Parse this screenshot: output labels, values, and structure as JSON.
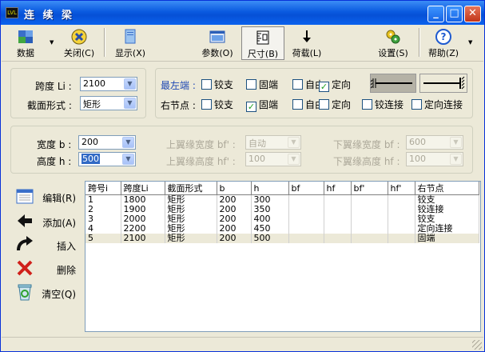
{
  "window": {
    "title": "连 续 梁",
    "app_icon_text": "LVL"
  },
  "titlebar_buttons": {
    "min": "_",
    "max": "□",
    "close": "✕"
  },
  "toolbar": {
    "data": {
      "label": "数据",
      "icon": "database-icon"
    },
    "close": {
      "label": "关闭(C)",
      "icon": "close-x-icon"
    },
    "show": {
      "label": "显示(X)",
      "icon": "document-icon"
    },
    "params": {
      "label": "参数(O)",
      "icon": "window-icon"
    },
    "size": {
      "label": "尺寸(B)",
      "icon": "ruler-icon"
    },
    "load": {
      "label": "荷载(L)",
      "icon": "arrow-down-icon"
    },
    "settings": {
      "label": "设置(S)",
      "icon": "gears-icon"
    },
    "help": {
      "label": "帮助(Z)",
      "icon": "help-icon"
    }
  },
  "span_group": {
    "span_label": "跨度 Li :",
    "span_value": "2100",
    "section_label": "截面形式 :",
    "section_value": "矩形"
  },
  "support_group": {
    "left_end_label": "最左端 :",
    "right_node_label": "右节点 :",
    "left_options": [
      {
        "label": "铰支",
        "checked": false
      },
      {
        "label": "固端",
        "checked": false
      },
      {
        "label": "自由",
        "checked": false
      },
      {
        "label": "定向",
        "checked": true
      }
    ],
    "right_options": [
      {
        "label": "铰支",
        "checked": false
      },
      {
        "label": "固端",
        "checked": true
      },
      {
        "label": "自由",
        "checked": false
      },
      {
        "label": "定向",
        "checked": false
      },
      {
        "label": "铰连接",
        "checked": false
      },
      {
        "label": "定向连接",
        "checked": false
      }
    ]
  },
  "size_group": {
    "width_label": "宽度 b :",
    "width_value": "200",
    "height_label": "高度 h :",
    "height_value": "500",
    "top_flange_width_label": "上翼缘宽度 bf' :",
    "top_flange_width_value": "自动",
    "top_flange_height_label": "上翼缘高度 hf' :",
    "top_flange_height_value": "100",
    "bottom_flange_width_label": "下翼缘宽度 bf :",
    "bottom_flange_width_value": "600",
    "bottom_flange_height_label": "下翼缘高度 hf :",
    "bottom_flange_height_value": "100"
  },
  "actions": {
    "edit": "编辑(R)",
    "add": "添加(A)",
    "insert": "插入",
    "delete": "删除",
    "clear": "清空(Q)"
  },
  "table": {
    "headers": [
      "跨号i",
      "跨度Li",
      "截面形式",
      "b",
      "h",
      "bf",
      "hf",
      "bf'",
      "hf'",
      "右节点"
    ],
    "rows": [
      [
        "1",
        "1800",
        "矩形",
        "200",
        "300",
        "",
        "",
        "",
        "",
        "铰支"
      ],
      [
        "2",
        "1900",
        "矩形",
        "200",
        "350",
        "",
        "",
        "",
        "",
        "铰连接"
      ],
      [
        "3",
        "2000",
        "矩形",
        "200",
        "400",
        "",
        "",
        "",
        "",
        "铰支"
      ],
      [
        "4",
        "2200",
        "矩形",
        "200",
        "450",
        "",
        "",
        "",
        "",
        "定向连接"
      ],
      [
        "5",
        "2100",
        "矩形",
        "200",
        "500",
        "",
        "",
        "",
        "",
        "固端"
      ]
    ],
    "selected_row": 4
  }
}
